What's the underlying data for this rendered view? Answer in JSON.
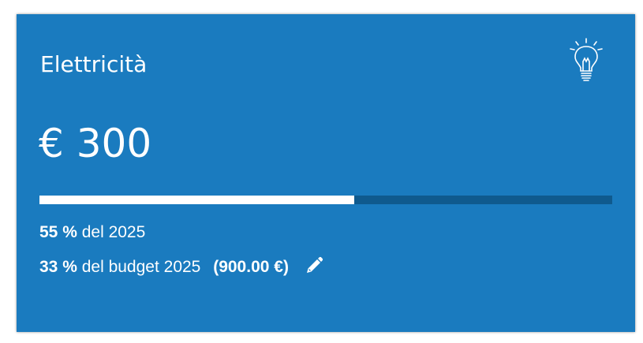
{
  "card": {
    "title": "Elettricità",
    "amount": "€ 300",
    "progress_fraction": 0.55,
    "year_stat": {
      "percent": "55 %",
      "text": "del 2025"
    },
    "budget_stat": {
      "percent": "33 %",
      "text": "del budget 2025",
      "budget_amount": "(900.00 €)"
    },
    "icons": {
      "category": "lightbulb-icon",
      "edit": "pencil-icon"
    },
    "colors": {
      "background": "#1a7bbf",
      "track": "#0f5a8e",
      "fill": "#ffffff"
    }
  }
}
